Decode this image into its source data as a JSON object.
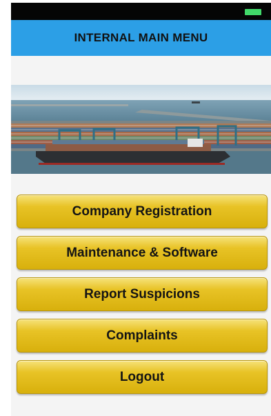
{
  "header": {
    "title": "INTERNAL MAIN MENU"
  },
  "status_bar": {
    "battery_icon": "battery-icon",
    "battery_color": "#41d96a"
  },
  "banner": {
    "image": "container-port-photo"
  },
  "menu": {
    "items": [
      {
        "label": "Company Registration"
      },
      {
        "label": "Maintenance & Software"
      },
      {
        "label": "Report Suspicions"
      },
      {
        "label": "Complaints"
      },
      {
        "label": "Logout"
      }
    ]
  },
  "colors": {
    "nav_bar": "#2c9fe6",
    "button_gold": "#e8c326",
    "background": "#f4f4f4"
  }
}
